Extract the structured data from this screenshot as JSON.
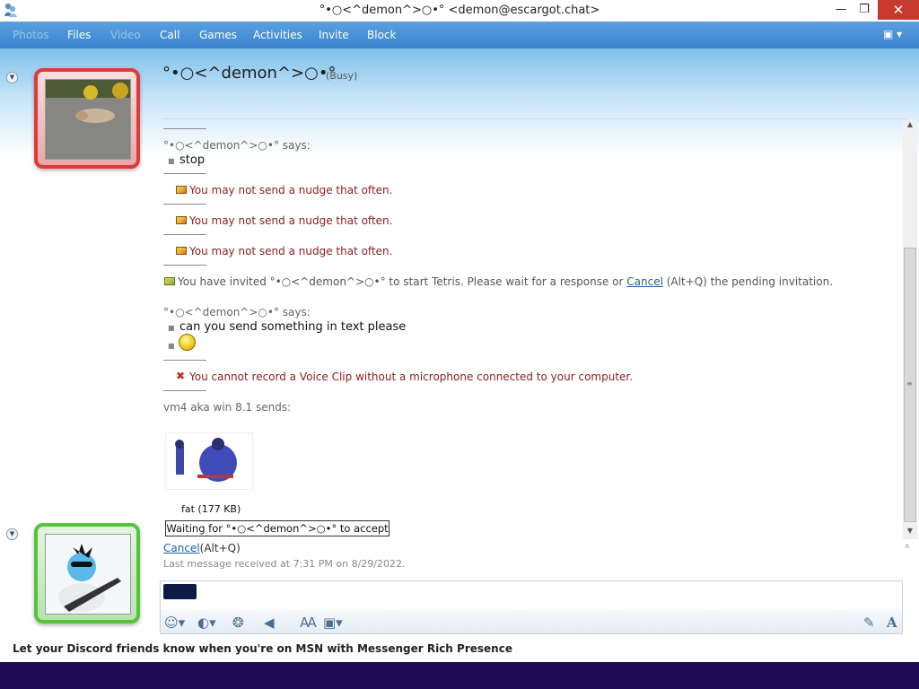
{
  "window": {
    "title": "°•○<^demon^>○•° <demon@escargot.chat>",
    "controls": {
      "minimize": "—",
      "maximize": "❐",
      "close": "✕"
    }
  },
  "menu": {
    "items": [
      {
        "label": "Photos",
        "enabled": false
      },
      {
        "label": "Files",
        "enabled": true
      },
      {
        "label": "Video",
        "enabled": false
      },
      {
        "label": "Call",
        "enabled": true
      },
      {
        "label": "Games",
        "enabled": true
      },
      {
        "label": "Activities",
        "enabled": true
      },
      {
        "label": "Invite",
        "enabled": true
      },
      {
        "label": "Block",
        "enabled": true
      }
    ],
    "layout_button": "▣ ▾"
  },
  "contact": {
    "name": "°•○<^demon^>○•°",
    "status": "(Busy)",
    "frame_color": "#e0393a"
  },
  "self": {
    "frame_color": "#55c43c"
  },
  "conversation": {
    "says1": "°•○<^demon^>○•° says:",
    "msg_stop": "stop",
    "nudge1": "You may not send a nudge that often.",
    "nudge2": "You may not send a nudge that often.",
    "nudge3": "You may not send a nudge that often.",
    "invite_prefix": "You have invited °•○<^demon^>○•° to start Tetris. Please wait for a response or",
    "invite_cancel": "Cancel",
    "invite_suffix": "(Alt+Q) the pending invitation.",
    "says2": "°•○<^demon^>○•° says:",
    "msg_text_please": "can you send something in text please",
    "voice_clip": "You cannot record a Voice Clip without a microphone connected to your computer.",
    "sends": "vm4 aka win 8.1 sends:",
    "file_name": "fat (177 KB)",
    "waiting": "Waiting for °•○<^demon^>○•° to accept",
    "cancel_link": "Cancel",
    "cancel_shortcut": "(Alt+Q)",
    "last_received": "Last message received at 7:31 PM on 8/29/2022."
  },
  "compose": {
    "tools": [
      "emoticon-icon",
      "wink-icon",
      "nudge-icon",
      "voice-clip-icon",
      "spell-icon",
      "background-icon",
      "handwriting-icon",
      "font-icon"
    ]
  },
  "adbar": {
    "text": "Let your Discord friends know when you're on MSN with Messenger Rich Presence"
  },
  "colors": {
    "menu_bg": "#3a84cf",
    "taskbar": "#1c0a52",
    "error_text": "#8b1d1d",
    "link": "#1f5fa8"
  }
}
